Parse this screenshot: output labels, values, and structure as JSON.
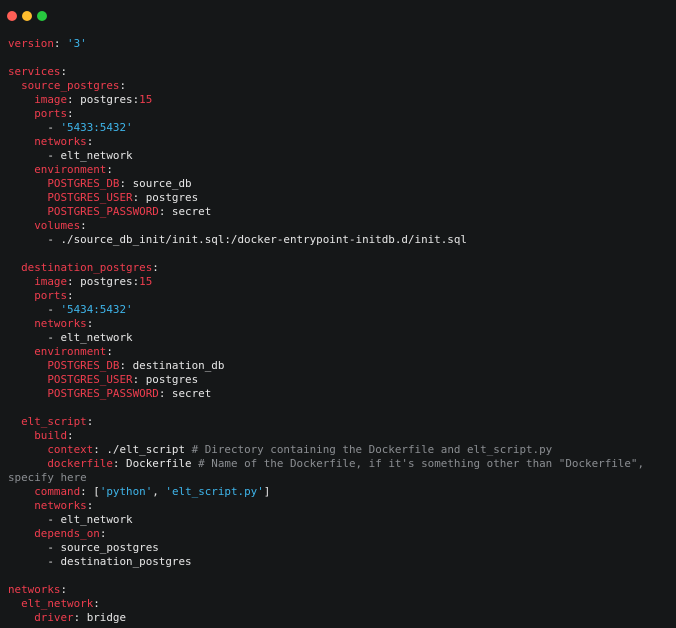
{
  "window": {
    "controls": {
      "close_color": "#ff5f56",
      "minimize_color": "#ffbd2e",
      "maximize_color": "#27c93f"
    }
  },
  "colors": {
    "background": "#151718",
    "key": "#ee3d4e",
    "string": "#3eb4e9",
    "comment": "#8a8d91",
    "text": "#e6e6e6"
  },
  "code": {
    "lines": [
      [
        {
          "t": "k",
          "v": "version"
        },
        {
          "t": "v",
          "v": ": "
        },
        {
          "t": "s",
          "v": "'3'"
        }
      ],
      [],
      [
        {
          "t": "k",
          "v": "services"
        },
        {
          "t": "v",
          "v": ":"
        }
      ],
      [
        {
          "t": "v",
          "v": "  "
        },
        {
          "t": "k",
          "v": "source_postgres"
        },
        {
          "t": "v",
          "v": ":"
        }
      ],
      [
        {
          "t": "v",
          "v": "    "
        },
        {
          "t": "k",
          "v": "image"
        },
        {
          "t": "v",
          "v": ": postgres:"
        },
        {
          "t": "n",
          "v": "15"
        }
      ],
      [
        {
          "t": "v",
          "v": "    "
        },
        {
          "t": "k",
          "v": "ports"
        },
        {
          "t": "v",
          "v": ":"
        }
      ],
      [
        {
          "t": "v",
          "v": "      - "
        },
        {
          "t": "s",
          "v": "'5433:5432'"
        }
      ],
      [
        {
          "t": "v",
          "v": "    "
        },
        {
          "t": "k",
          "v": "networks"
        },
        {
          "t": "v",
          "v": ":"
        }
      ],
      [
        {
          "t": "v",
          "v": "      - elt_network"
        }
      ],
      [
        {
          "t": "v",
          "v": "    "
        },
        {
          "t": "k",
          "v": "environment"
        },
        {
          "t": "v",
          "v": ":"
        }
      ],
      [
        {
          "t": "v",
          "v": "      "
        },
        {
          "t": "k",
          "v": "POSTGRES_DB"
        },
        {
          "t": "v",
          "v": ": source_db"
        }
      ],
      [
        {
          "t": "v",
          "v": "      "
        },
        {
          "t": "k",
          "v": "POSTGRES_USER"
        },
        {
          "t": "v",
          "v": ": postgres"
        }
      ],
      [
        {
          "t": "v",
          "v": "      "
        },
        {
          "t": "k",
          "v": "POSTGRES_PASSWORD"
        },
        {
          "t": "v",
          "v": ": secret"
        }
      ],
      [
        {
          "t": "v",
          "v": "    "
        },
        {
          "t": "k",
          "v": "volumes"
        },
        {
          "t": "v",
          "v": ":"
        }
      ],
      [
        {
          "t": "v",
          "v": "      - ./source_db_init/init.sql:/docker-entrypoint-initdb.d/init.sql"
        }
      ],
      [],
      [
        {
          "t": "v",
          "v": "  "
        },
        {
          "t": "k",
          "v": "destination_postgres"
        },
        {
          "t": "v",
          "v": ":"
        }
      ],
      [
        {
          "t": "v",
          "v": "    "
        },
        {
          "t": "k",
          "v": "image"
        },
        {
          "t": "v",
          "v": ": postgres:"
        },
        {
          "t": "n",
          "v": "15"
        }
      ],
      [
        {
          "t": "v",
          "v": "    "
        },
        {
          "t": "k",
          "v": "ports"
        },
        {
          "t": "v",
          "v": ":"
        }
      ],
      [
        {
          "t": "v",
          "v": "      - "
        },
        {
          "t": "s",
          "v": "'5434:5432'"
        }
      ],
      [
        {
          "t": "v",
          "v": "    "
        },
        {
          "t": "k",
          "v": "networks"
        },
        {
          "t": "v",
          "v": ":"
        }
      ],
      [
        {
          "t": "v",
          "v": "      - elt_network"
        }
      ],
      [
        {
          "t": "v",
          "v": "    "
        },
        {
          "t": "k",
          "v": "environment"
        },
        {
          "t": "v",
          "v": ":"
        }
      ],
      [
        {
          "t": "v",
          "v": "      "
        },
        {
          "t": "k",
          "v": "POSTGRES_DB"
        },
        {
          "t": "v",
          "v": ": destination_db"
        }
      ],
      [
        {
          "t": "v",
          "v": "      "
        },
        {
          "t": "k",
          "v": "POSTGRES_USER"
        },
        {
          "t": "v",
          "v": ": postgres"
        }
      ],
      [
        {
          "t": "v",
          "v": "      "
        },
        {
          "t": "k",
          "v": "POSTGRES_PASSWORD"
        },
        {
          "t": "v",
          "v": ": secret"
        }
      ],
      [],
      [
        {
          "t": "v",
          "v": "  "
        },
        {
          "t": "k",
          "v": "elt_script"
        },
        {
          "t": "v",
          "v": ":"
        }
      ],
      [
        {
          "t": "v",
          "v": "    "
        },
        {
          "t": "k",
          "v": "build"
        },
        {
          "t": "v",
          "v": ":"
        }
      ],
      [
        {
          "t": "v",
          "v": "      "
        },
        {
          "t": "k",
          "v": "context"
        },
        {
          "t": "v",
          "v": ": ./elt_script "
        },
        {
          "t": "c",
          "v": "# Directory containing the Dockerfile and elt_script.py"
        }
      ],
      [
        {
          "t": "v",
          "v": "      "
        },
        {
          "t": "k",
          "v": "dockerfile"
        },
        {
          "t": "v",
          "v": ": Dockerfile "
        },
        {
          "t": "c",
          "v": "# Name of the Dockerfile, if it's something other than \"Dockerfile\","
        }
      ],
      [
        {
          "t": "c",
          "v": "specify here"
        }
      ],
      [
        {
          "t": "v",
          "v": "    "
        },
        {
          "t": "k",
          "v": "command"
        },
        {
          "t": "v",
          "v": ": ["
        },
        {
          "t": "s",
          "v": "'python'"
        },
        {
          "t": "v",
          "v": ", "
        },
        {
          "t": "s",
          "v": "'elt_script.py'"
        },
        {
          "t": "v",
          "v": "]"
        }
      ],
      [
        {
          "t": "v",
          "v": "    "
        },
        {
          "t": "k",
          "v": "networks"
        },
        {
          "t": "v",
          "v": ":"
        }
      ],
      [
        {
          "t": "v",
          "v": "      - elt_network"
        }
      ],
      [
        {
          "t": "v",
          "v": "    "
        },
        {
          "t": "k",
          "v": "depends_on"
        },
        {
          "t": "v",
          "v": ":"
        }
      ],
      [
        {
          "t": "v",
          "v": "      - source_postgres"
        }
      ],
      [
        {
          "t": "v",
          "v": "      - destination_postgres"
        }
      ],
      [],
      [
        {
          "t": "k",
          "v": "networks"
        },
        {
          "t": "v",
          "v": ":"
        }
      ],
      [
        {
          "t": "v",
          "v": "  "
        },
        {
          "t": "k",
          "v": "elt_network"
        },
        {
          "t": "v",
          "v": ":"
        }
      ],
      [
        {
          "t": "v",
          "v": "    "
        },
        {
          "t": "k",
          "v": "driver"
        },
        {
          "t": "v",
          "v": ": bridge"
        }
      ]
    ]
  }
}
